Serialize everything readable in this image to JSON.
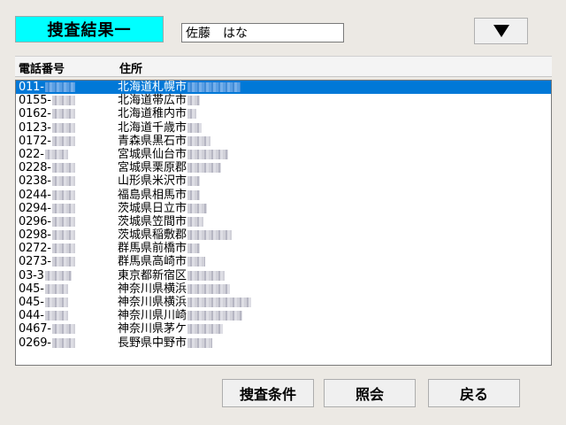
{
  "header": {
    "title": "捜査結果一",
    "search_value": "佐藤　はな",
    "dropdown_icon": "triangle-down-icon"
  },
  "list": {
    "columns": [
      "電話番号",
      "住所"
    ],
    "rows": [
      {
        "phone": "011-",
        "addr": "北海道札幌市",
        "selected": true
      },
      {
        "phone": "0155-",
        "addr": "北海道帯広市"
      },
      {
        "phone": "0162-",
        "addr": "北海道稚内市"
      },
      {
        "phone": "0123-",
        "addr": "北海道千歳市"
      },
      {
        "phone": "0172-",
        "addr": "青森県黒石市"
      },
      {
        "phone": "022-",
        "addr": "宮城県仙台市"
      },
      {
        "phone": "0228-",
        "addr": "宮城県栗原郡"
      },
      {
        "phone": "0238-",
        "addr": "山形県米沢市"
      },
      {
        "phone": "0244-",
        "addr": "福島県相馬市"
      },
      {
        "phone": "0294-",
        "addr": "茨城県日立市"
      },
      {
        "phone": "0296-",
        "addr": "茨城県笠間市"
      },
      {
        "phone": "0298-",
        "addr": "茨城県稲敷郡"
      },
      {
        "phone": "0272-",
        "addr": "群馬県前橋市"
      },
      {
        "phone": "0273-",
        "addr": "群馬県高崎市"
      },
      {
        "phone": "03-3",
        "addr": "東京都新宿区"
      },
      {
        "phone": "045-",
        "addr": "神奈川県横浜"
      },
      {
        "phone": "045-",
        "addr": "神奈川県横浜"
      },
      {
        "phone": "044-",
        "addr": "神奈川県川崎"
      },
      {
        "phone": "0467-",
        "addr": "神奈川県茅ケ"
      },
      {
        "phone": "0269-",
        "addr": "長野県中野市"
      }
    ]
  },
  "buttons": {
    "search_conditions": "捜査条件",
    "inquiry": "照会",
    "back": "戻る"
  },
  "colors": {
    "title_bg": "#00ffff",
    "selection": "#0078d7"
  }
}
